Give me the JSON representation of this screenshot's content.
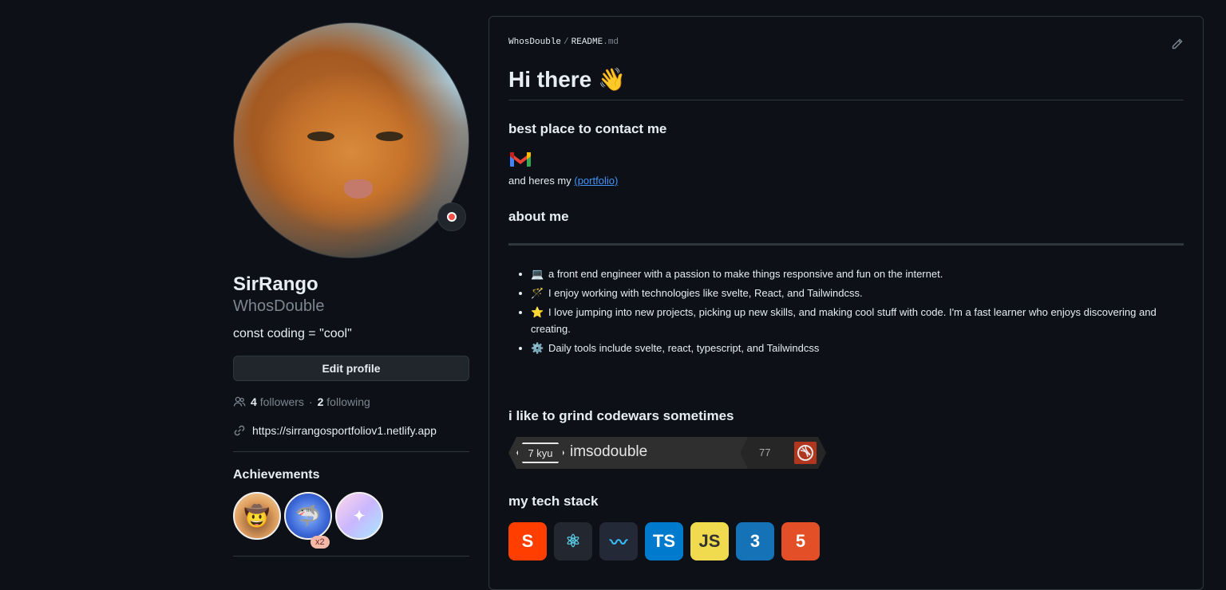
{
  "profile": {
    "name": "SirRango",
    "login": "WhosDouble",
    "bio": "const coding = \"cool\"",
    "edit_label": "Edit profile",
    "followers_count": "4",
    "followers_label": "followers",
    "sep": "·",
    "following_count": "2",
    "following_label": "following",
    "website": "https://sirrangosportfoliov1.netlify.app",
    "achievements_title": "Achievements",
    "achievement_multiplier": "x2"
  },
  "readme": {
    "owner": "WhosDouble",
    "separator": "/",
    "file_base": "README",
    "file_ext": ".md",
    "heading": "Hi there",
    "heading_emoji": "👋",
    "contact_heading": "best place to contact me",
    "portfolio_prefix": "and heres my ",
    "portfolio_link": "(portfolio)",
    "about_heading": "about me",
    "about_items": [
      {
        "icon": "💻",
        "text": "a front end engineer with a passion to make things responsive and fun on the internet."
      },
      {
        "icon": "🪄",
        "text": "I enjoy working with technologies like svelte, React, and Tailwindcss."
      },
      {
        "icon": "⭐",
        "text": "I love jumping into new projects, picking up new skills, and making cool stuff with code. I'm a fast learner who enjoys discovering and creating."
      },
      {
        "icon": "⚙️",
        "text": "Daily tools include svelte, react, typescript, and Tailwindcss"
      }
    ],
    "codewars_heading": "i like to grind codewars sometimes",
    "codewars": {
      "rank": "7 kyu",
      "username": "imsodouble",
      "score": "77"
    },
    "stack_heading": "my tech stack",
    "stack": [
      {
        "name": "svelte-icon",
        "label": "S",
        "bg": "#ff3e00",
        "fg": "#ffffff"
      },
      {
        "name": "react-icon",
        "label": "⚛",
        "bg": "#23272f",
        "fg": "#58c4dc"
      },
      {
        "name": "tailwind-icon",
        "label": "〰",
        "bg": "#242938",
        "fg": "#38bdf8"
      },
      {
        "name": "typescript-icon",
        "label": "TS",
        "bg": "#007acc",
        "fg": "#ffffff"
      },
      {
        "name": "javascript-icon",
        "label": "JS",
        "bg": "#f0db4f",
        "fg": "#323330"
      },
      {
        "name": "css3-icon",
        "label": "3",
        "bg": "#1572b6",
        "fg": "#ffffff"
      },
      {
        "name": "html5-icon",
        "label": "5",
        "bg": "#e34f26",
        "fg": "#ffffff"
      }
    ]
  }
}
